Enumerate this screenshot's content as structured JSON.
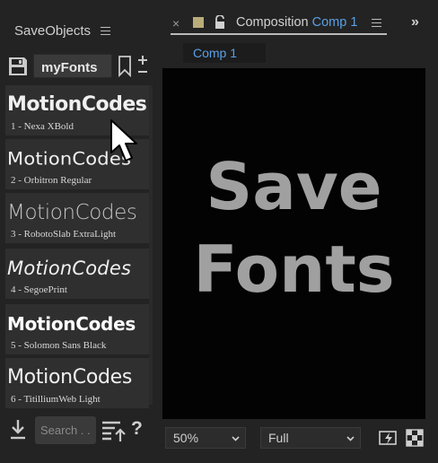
{
  "left_panel": {
    "title": "SaveObjects",
    "preset_name": "myFonts",
    "fonts": [
      {
        "preview": "MotionCodes",
        "label": "1 - Nexa  XBold"
      },
      {
        "preview": "MotionCodes",
        "label": "2 - Orbitron  Regular"
      },
      {
        "preview": "MotionCodes",
        "label": "3 - RobotoSlab  ExtraLight"
      },
      {
        "preview": "MotionCodes",
        "label": "4 - SegoePrint"
      },
      {
        "preview": "MotionCodes",
        "label": "5 - Solomon  Sans  Black"
      },
      {
        "preview": "MotionCodes",
        "label": "6 - TitilliumWeb  Light"
      }
    ],
    "search_placeholder": "Search . .",
    "help_label": "?"
  },
  "composition_panel": {
    "close_label": "×",
    "tab_prefix": "Composition",
    "tab_comp_name": "Comp 1",
    "overflow_label": "»",
    "comp_tab_label": "Comp 1",
    "viewer_lines": [
      "Save",
      "Fonts"
    ],
    "zoom_value": "50%",
    "resolution_value": "Full"
  },
  "colors": {
    "accent_blue": "#5aa0e8",
    "label_swatch": "#b8ad7a",
    "viewer_text": "#a0a0a0"
  },
  "icons": [
    "hamburger-menu-icon",
    "save-icon",
    "bookmark-icon",
    "plus-minus-icon",
    "cursor-icon",
    "download-icon",
    "sort-icon",
    "help-icon",
    "close-icon",
    "lock-icon",
    "fast-previews-icon",
    "transparency-grid-icon"
  ]
}
